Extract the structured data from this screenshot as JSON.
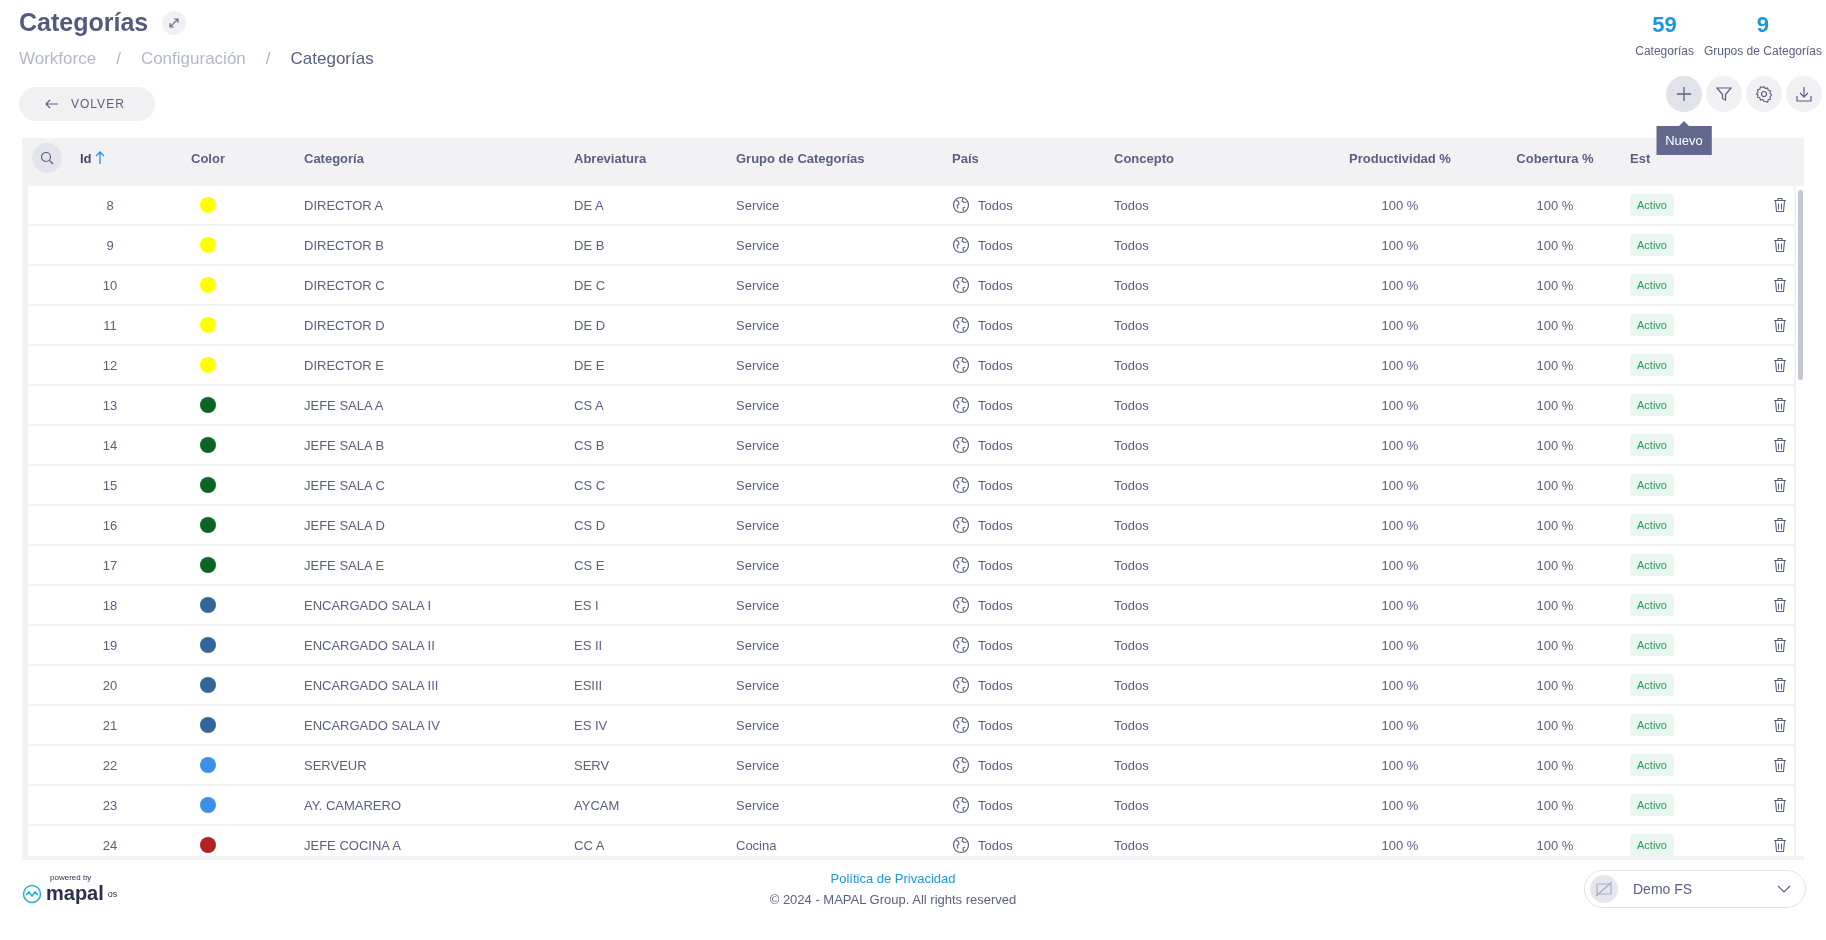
{
  "page": {
    "title": "Categorías",
    "breadcrumb": [
      {
        "label": "Workforce",
        "current": false
      },
      {
        "label": "Configuración",
        "current": false
      },
      {
        "label": "Categorías",
        "current": true
      }
    ],
    "back_button": "VOLVER",
    "separator": "/"
  },
  "stats": [
    {
      "value": "59",
      "label": "Categorías"
    },
    {
      "value": "9",
      "label": "Grupos de Categorías"
    }
  ],
  "actions": [
    {
      "kind": "add",
      "hovered": true
    },
    {
      "kind": "filter",
      "hovered": false
    },
    {
      "kind": "settings",
      "hovered": false
    },
    {
      "kind": "download",
      "hovered": false
    }
  ],
  "tooltip": "Nuevo",
  "table": {
    "columns": [
      {
        "label": "Id",
        "sorted": true
      },
      {
        "label": "Color",
        "sorted": false
      },
      {
        "label": "Categoría",
        "sorted": false
      },
      {
        "label": "Abreviatura",
        "sorted": false
      },
      {
        "label": "Grupo de Categorías",
        "sorted": false
      },
      {
        "label": "País",
        "sorted": false
      },
      {
        "label": "Concepto",
        "sorted": false
      },
      {
        "label": "Productividad %",
        "sorted": false
      },
      {
        "label": "Cobertura %",
        "sorted": false
      },
      {
        "label": "Est",
        "sorted": false
      }
    ],
    "rows": [
      {
        "id": "8",
        "color": "#ffff00",
        "name": "DIRECTOR A",
        "abbr": "DE A",
        "group": "Service",
        "country": "Todos",
        "concept": "Todos",
        "productivity": "100 %",
        "coverage": "100 %",
        "status": "Activo"
      },
      {
        "id": "9",
        "color": "#ffff00",
        "name": "DIRECTOR B",
        "abbr": "DE B",
        "group": "Service",
        "country": "Todos",
        "concept": "Todos",
        "productivity": "100 %",
        "coverage": "100 %",
        "status": "Activo"
      },
      {
        "id": "10",
        "color": "#ffff00",
        "name": "DIRECTOR C",
        "abbr": "DE C",
        "group": "Service",
        "country": "Todos",
        "concept": "Todos",
        "productivity": "100 %",
        "coverage": "100 %",
        "status": "Activo"
      },
      {
        "id": "11",
        "color": "#ffff00",
        "name": "DIRECTOR D",
        "abbr": "DE D",
        "group": "Service",
        "country": "Todos",
        "concept": "Todos",
        "productivity": "100 %",
        "coverage": "100 %",
        "status": "Activo"
      },
      {
        "id": "12",
        "color": "#ffff00",
        "name": "DIRECTOR E",
        "abbr": "DE E",
        "group": "Service",
        "country": "Todos",
        "concept": "Todos",
        "productivity": "100 %",
        "coverage": "100 %",
        "status": "Activo"
      },
      {
        "id": "13",
        "color": "#0b6623",
        "name": "JEFE SALA A",
        "abbr": "CS A",
        "group": "Service",
        "country": "Todos",
        "concept": "Todos",
        "productivity": "100 %",
        "coverage": "100 %",
        "status": "Activo"
      },
      {
        "id": "14",
        "color": "#0b6623",
        "name": "JEFE SALA B",
        "abbr": "CS B",
        "group": "Service",
        "country": "Todos",
        "concept": "Todos",
        "productivity": "100 %",
        "coverage": "100 %",
        "status": "Activo"
      },
      {
        "id": "15",
        "color": "#0b6623",
        "name": "JEFE SALA C",
        "abbr": "CS C",
        "group": "Service",
        "country": "Todos",
        "concept": "Todos",
        "productivity": "100 %",
        "coverage": "100 %",
        "status": "Activo"
      },
      {
        "id": "16",
        "color": "#0b6623",
        "name": "JEFE SALA D",
        "abbr": "CS D",
        "group": "Service",
        "country": "Todos",
        "concept": "Todos",
        "productivity": "100 %",
        "coverage": "100 %",
        "status": "Activo"
      },
      {
        "id": "17",
        "color": "#0b6623",
        "name": "JEFE SALA E",
        "abbr": "CS E",
        "group": "Service",
        "country": "Todos",
        "concept": "Todos",
        "productivity": "100 %",
        "coverage": "100 %",
        "status": "Activo"
      },
      {
        "id": "18",
        "color": "#336699",
        "name": "ENCARGADO SALA I",
        "abbr": "ES I",
        "group": "Service",
        "country": "Todos",
        "concept": "Todos",
        "productivity": "100 %",
        "coverage": "100 %",
        "status": "Activo"
      },
      {
        "id": "19",
        "color": "#336699",
        "name": "ENCARGADO SALA II",
        "abbr": "ES II",
        "group": "Service",
        "country": "Todos",
        "concept": "Todos",
        "productivity": "100 %",
        "coverage": "100 %",
        "status": "Activo"
      },
      {
        "id": "20",
        "color": "#336699",
        "name": "ENCARGADO SALA III",
        "abbr": "ESIII",
        "group": "Service",
        "country": "Todos",
        "concept": "Todos",
        "productivity": "100 %",
        "coverage": "100 %",
        "status": "Activo"
      },
      {
        "id": "21",
        "color": "#336699",
        "name": "ENCARGADO SALA IV",
        "abbr": "ES IV",
        "group": "Service",
        "country": "Todos",
        "concept": "Todos",
        "productivity": "100 %",
        "coverage": "100 %",
        "status": "Activo"
      },
      {
        "id": "22",
        "color": "#3c8fe6",
        "name": "SERVEUR",
        "abbr": "SERV",
        "group": "Service",
        "country": "Todos",
        "concept": "Todos",
        "productivity": "100 %",
        "coverage": "100 %",
        "status": "Activo"
      },
      {
        "id": "23",
        "color": "#3c8fe6",
        "name": "AY. CAMARERO",
        "abbr": "AYCAM",
        "group": "Service",
        "country": "Todos",
        "concept": "Todos",
        "productivity": "100 %",
        "coverage": "100 %",
        "status": "Activo"
      },
      {
        "id": "24",
        "color": "#b22222",
        "name": "JEFE COCINA A",
        "abbr": "CC A",
        "group": "Cocina",
        "country": "Todos",
        "concept": "Todos",
        "productivity": "100 %",
        "coverage": "100 %",
        "status": "Activo"
      }
    ]
  },
  "footer": {
    "powered_by": "powered by",
    "logo": "mapal",
    "logo_suffix": "os",
    "privacy_link": "Política de Privacidad",
    "copyright": "© 2024 - MAPAL Group. All rights reserved",
    "account": "Demo FS"
  }
}
